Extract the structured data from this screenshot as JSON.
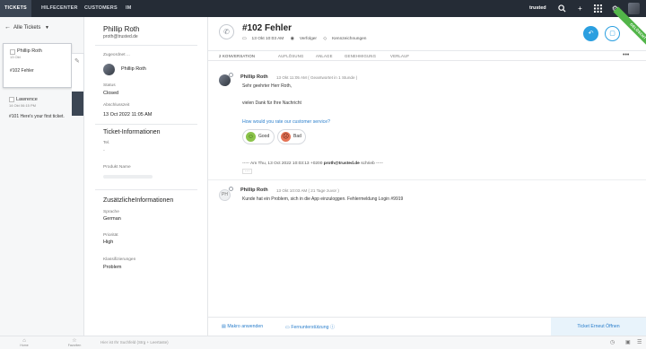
{
  "topnav": {
    "tabs": [
      "TICKETS",
      "HILFECENTER",
      "CUSTOMERS",
      "IM"
    ],
    "active_tab": "TICKETS",
    "account": "trusted",
    "icons": [
      "search-icon",
      "plus-icon",
      "grid-icon",
      "gear-icon",
      "user-avatar"
    ]
  },
  "ticket_list": {
    "back_label": "Alle Tickets",
    "items": [
      {
        "name": "Phillip Roth",
        "date": "13 Okt",
        "subject": "#102  Fehler"
      },
      {
        "name": "Lawrence",
        "date": "14 Okt 06:15 PM",
        "subject": "#101  Here's your first ticket."
      }
    ]
  },
  "customer": {
    "name": "Phillip Roth",
    "email": "proth@trusted.de",
    "assigned_label": "Zugeordnet ...",
    "assigned_value": "Phillip Roth",
    "status_label": "Status",
    "status_value": "Closed",
    "closed_label": "Abschlusszeit",
    "closed_value": "13 Oct 2022 11:05 AM",
    "info_title": "Ticket-Informationen",
    "tel_label": "Tel.",
    "tel_value": "-",
    "product_label": "Produkt Name",
    "extra_title": "ZusätzlicheInformationen",
    "lang_label": "Sprache",
    "lang_value": "German",
    "prio_label": "Priorität",
    "prio_value": "High",
    "class_label": "Klassifizierungen",
    "class_value": "Problem"
  },
  "ticket": {
    "title": "#102  Fehler",
    "date": "13 Okt 10:03 AM",
    "tracked": "Verfolger",
    "tags": "Kennzeichnungen",
    "ribbon": "GELÖSCHT",
    "accent": "#2b9fe0",
    "tabs": [
      "2 KONVERSATION",
      "AUFLÖSUNG",
      "ANLAGE",
      "GENEHMIGUNG",
      "VERLAUF"
    ]
  },
  "messages": {
    "reply": {
      "author": "Phillip Roth",
      "date": "13 Okt 11:05 AM ( Geantwortet in 1 Stunde )",
      "greeting": "Sehr geehrter Herr Roth,",
      "body": "vielen Dank für Ihre Nachricht",
      "rating_prompt": "How would you rate our customer service?",
      "good_label": "Good",
      "bad_label": "Bad",
      "quote_prefix": "----- Am  Thu, 13 Oct 2022 10:03:13 +0200",
      "quote_email": "proth@trusted.de",
      "quote_suffix": "schrieb -----"
    },
    "original": {
      "initials": "PH",
      "author": "Phillip Roth",
      "date": "13 Okt 10:03 AM ( 21 Tage zuvor )",
      "body": "Kunde hat ein Problem, sich in die App einzuloggen. Fehlermeldung Login #9919"
    }
  },
  "bottom": {
    "macro": "Makro anwenden",
    "remote": "Fernunterstützung",
    "reopen": "Ticket Erneut Öffnen"
  },
  "footer": {
    "home": "Home",
    "favorites": "Favoriten",
    "search_placeholder": "Hier ist Ihr Suchfeld (Strg + Leertaste)"
  }
}
